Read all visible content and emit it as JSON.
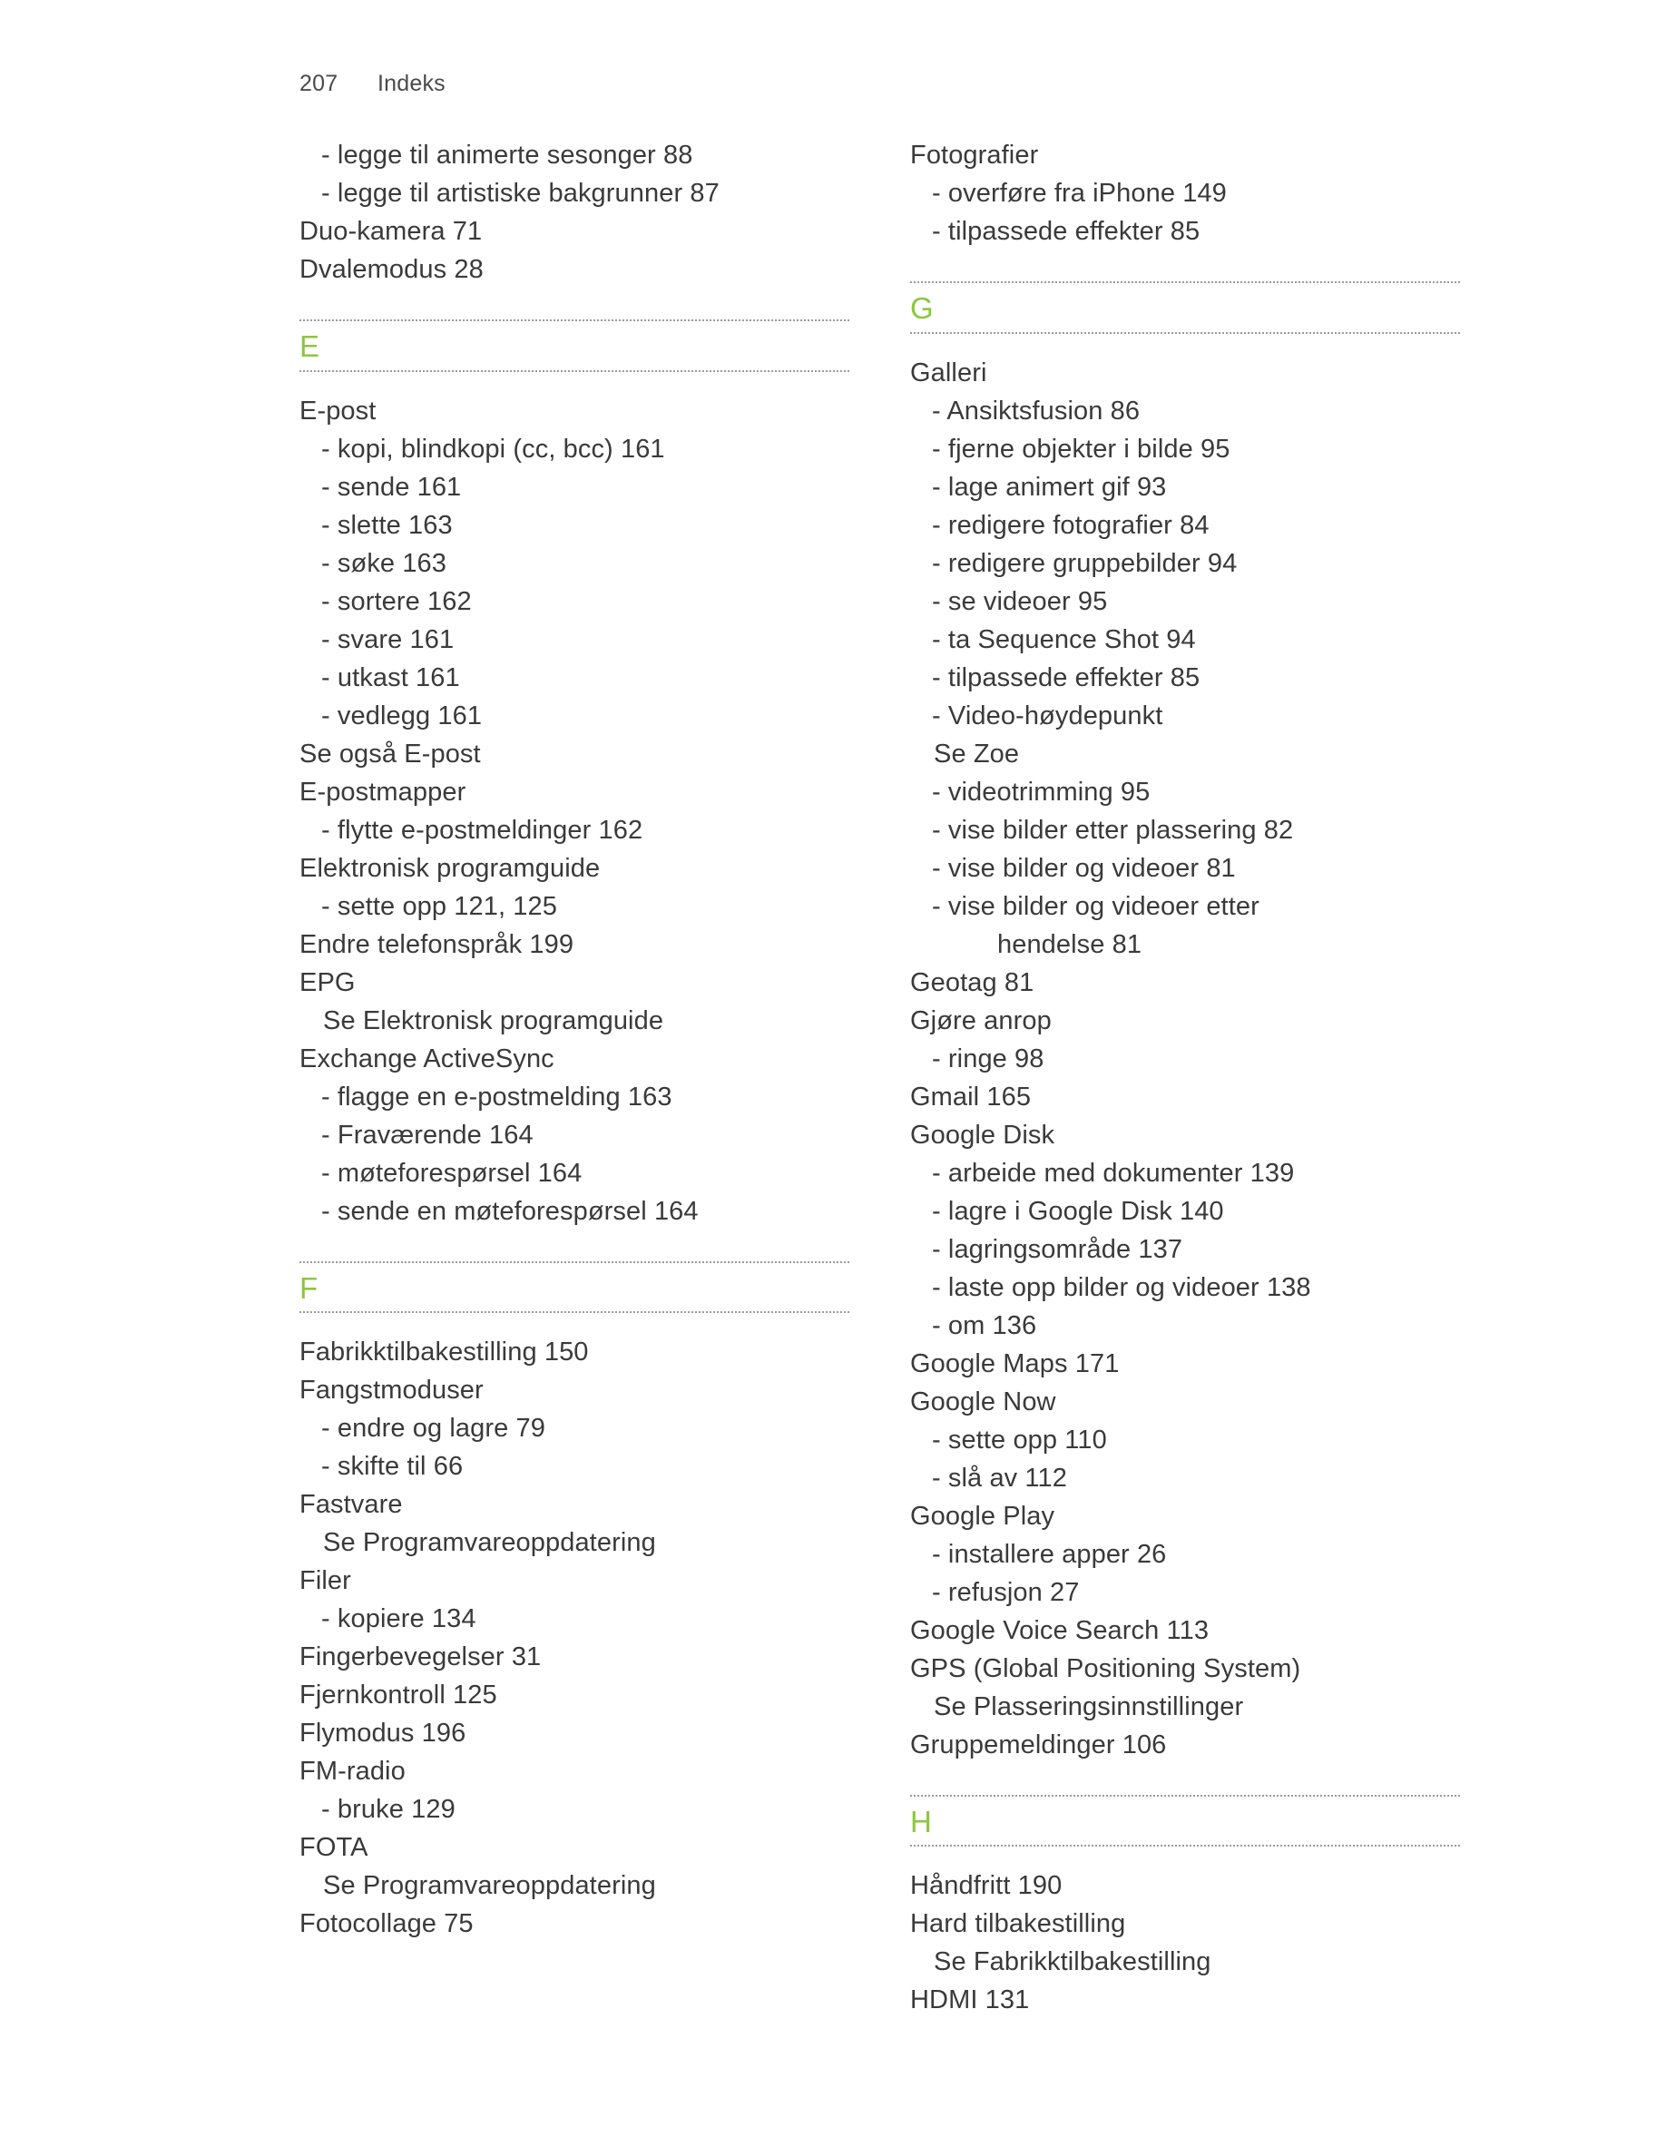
{
  "header": {
    "folio": "207",
    "section_name": "Indeks"
  },
  "theme": {
    "accent_green": "#8DC63F",
    "text_color": "#3a3a3a",
    "rule_color": "#9b9b9b",
    "background": "#ffffff"
  },
  "columns": [
    {
      "name": "left-column",
      "blocks": [
        {
          "type": "entries",
          "entries": [
            {
              "level": "sub",
              "text": "- legge til animerte sesonger  88"
            },
            {
              "level": "sub",
              "text": "- legge til artistiske bakgrunner  87"
            },
            {
              "level": "main",
              "text": "Duo-kamera  71"
            },
            {
              "level": "main",
              "text": "Dvalemodus  28"
            }
          ]
        },
        {
          "type": "letter",
          "letter": "E"
        },
        {
          "type": "entries",
          "entries": [
            {
              "level": "main",
              "text": "E-post"
            },
            {
              "level": "sub",
              "text": "- kopi, blindkopi (cc, bcc)  161"
            },
            {
              "level": "sub",
              "text": "- sende  161"
            },
            {
              "level": "sub",
              "text": "- slette  163"
            },
            {
              "level": "sub",
              "text": "- søke  163"
            },
            {
              "level": "sub",
              "text": "- sortere  162"
            },
            {
              "level": "sub",
              "text": "- svare  161"
            },
            {
              "level": "sub",
              "text": "- utkast  161"
            },
            {
              "level": "sub",
              "text": "- vedlegg  161"
            },
            {
              "level": "seealso",
              "text": "Se også E-post"
            },
            {
              "level": "main",
              "text": "E-postmapper"
            },
            {
              "level": "sub",
              "text": "- flytte e-postmeldinger  162"
            },
            {
              "level": "main",
              "text": "Elektronisk programguide"
            },
            {
              "level": "sub",
              "text": "- sette opp  121, 125"
            },
            {
              "level": "main",
              "text": "Endre telefonspråk  199"
            },
            {
              "level": "main",
              "text": "EPG"
            },
            {
              "level": "see",
              "text": "Se Elektronisk programguide"
            },
            {
              "level": "main",
              "text": "Exchange ActiveSync"
            },
            {
              "level": "sub",
              "text": "- flagge en e-postmelding  163"
            },
            {
              "level": "sub",
              "text": "- Fraværende  164"
            },
            {
              "level": "sub",
              "text": "- møteforespørsel  164"
            },
            {
              "level": "sub",
              "text": "- sende en møteforespørsel  164"
            }
          ]
        },
        {
          "type": "letter",
          "letter": "F"
        },
        {
          "type": "entries",
          "entries": [
            {
              "level": "main",
              "text": "Fabrikktilbakestilling  150"
            },
            {
              "level": "main",
              "text": "Fangstmoduser"
            },
            {
              "level": "sub",
              "text": "- endre og lagre  79"
            },
            {
              "level": "sub",
              "text": "- skifte til  66"
            },
            {
              "level": "main",
              "text": "Fastvare"
            },
            {
              "level": "see",
              "text": "Se Programvareoppdatering"
            },
            {
              "level": "main",
              "text": "Filer"
            },
            {
              "level": "sub",
              "text": "- kopiere  134"
            },
            {
              "level": "main",
              "text": "Fingerbevegelser  31"
            },
            {
              "level": "main",
              "text": "Fjernkontroll  125"
            },
            {
              "level": "main",
              "text": "Flymodus  196"
            },
            {
              "level": "main",
              "text": "FM-radio"
            },
            {
              "level": "sub",
              "text": "- bruke  129"
            },
            {
              "level": "main",
              "text": "FOTA"
            },
            {
              "level": "see",
              "text": "Se Programvareoppdatering"
            },
            {
              "level": "main",
              "text": "Fotocollage  75"
            }
          ]
        }
      ]
    },
    {
      "name": "right-column",
      "blocks": [
        {
          "type": "entries",
          "entries": [
            {
              "level": "main",
              "text": "Fotografier"
            },
            {
              "level": "sub",
              "text": "- overføre fra iPhone  149"
            },
            {
              "level": "sub",
              "text": "- tilpassede effekter  85"
            }
          ]
        },
        {
          "type": "letter",
          "letter": "G"
        },
        {
          "type": "entries",
          "entries": [
            {
              "level": "main",
              "text": "Galleri"
            },
            {
              "level": "sub",
              "text": "- Ansiktsfusion  86"
            },
            {
              "level": "sub",
              "text": "- fjerne objekter i bilde  95"
            },
            {
              "level": "sub",
              "text": "- lage animert gif  93"
            },
            {
              "level": "sub",
              "text": "- redigere fotografier  84"
            },
            {
              "level": "sub",
              "text": "- redigere gruppebilder  94"
            },
            {
              "level": "sub",
              "text": "- se videoer  95"
            },
            {
              "level": "sub",
              "text": "- ta Sequence Shot  94"
            },
            {
              "level": "sub",
              "text": "- tilpassede effekter  85"
            },
            {
              "level": "sub",
              "text": "- Video-høydepunkt"
            },
            {
              "level": "see",
              "text": "Se Zoe"
            },
            {
              "level": "sub",
              "text": "- videotrimming  95"
            },
            {
              "level": "sub",
              "text": "- vise bilder etter plassering  82"
            },
            {
              "level": "sub",
              "text": "- vise bilder og videoer  81"
            },
            {
              "level": "sub",
              "text": "- vise bilder og videoer etter"
            },
            {
              "level": "cont",
              "text": "hendelse  81"
            },
            {
              "level": "main",
              "text": "Geotag  81"
            },
            {
              "level": "main",
              "text": "Gjøre anrop"
            },
            {
              "level": "sub",
              "text": "- ringe  98"
            },
            {
              "level": "main",
              "text": "Gmail  165"
            },
            {
              "level": "main",
              "text": "Google Disk"
            },
            {
              "level": "sub",
              "text": "- arbeide med dokumenter  139"
            },
            {
              "level": "sub",
              "text": "- lagre i Google Disk  140"
            },
            {
              "level": "sub",
              "text": "- lagringsområde  137"
            },
            {
              "level": "sub",
              "text": "- laste opp bilder og videoer  138"
            },
            {
              "level": "sub",
              "text": "- om  136"
            },
            {
              "level": "main",
              "text": "Google Maps  171"
            },
            {
              "level": "main",
              "text": "Google Now"
            },
            {
              "level": "sub",
              "text": "- sette opp  110"
            },
            {
              "level": "sub",
              "text": "- slå av  112"
            },
            {
              "level": "main",
              "text": "Google Play"
            },
            {
              "level": "sub",
              "text": "- installere apper  26"
            },
            {
              "level": "sub",
              "text": "- refusjon  27"
            },
            {
              "level": "main",
              "text": "Google Voice Search  113"
            },
            {
              "level": "main",
              "text": "GPS (Global Positioning System)"
            },
            {
              "level": "see",
              "text": "Se Plasseringsinnstillinger"
            },
            {
              "level": "main",
              "text": "Gruppemeldinger  106"
            }
          ]
        },
        {
          "type": "letter",
          "letter": "H"
        },
        {
          "type": "entries",
          "entries": [
            {
              "level": "main",
              "text": "Håndfritt  190"
            },
            {
              "level": "main",
              "text": "Hard tilbakestilling"
            },
            {
              "level": "see",
              "text": "Se Fabrikktilbakestilling"
            },
            {
              "level": "main",
              "text": "HDMI  131"
            }
          ]
        }
      ]
    }
  ]
}
